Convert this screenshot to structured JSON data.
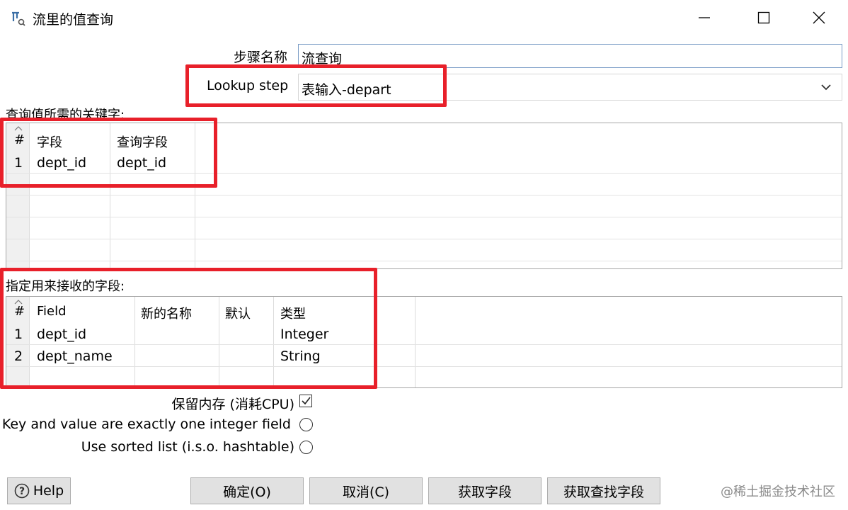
{
  "window": {
    "title": "流里的值查询",
    "icon": "lookup-step-icon"
  },
  "form": {
    "step_name_label": "步骤名称",
    "step_name_value": "流查询",
    "lookup_step_label": "Lookup step",
    "lookup_step_value": "表输入-depart"
  },
  "keys_section": {
    "label": "查询值所需的关键字:",
    "headers": [
      "#",
      "字段",
      "查询字段"
    ],
    "rows": [
      [
        "1",
        "dept_id",
        "dept_id"
      ]
    ]
  },
  "fields_section": {
    "label": "指定用来接收的字段:",
    "headers": [
      "#",
      "Field",
      "新的名称",
      "默认",
      "类型"
    ],
    "rows": [
      [
        "1",
        "dept_id",
        "",
        "",
        "Integer"
      ],
      [
        "2",
        "dept_name",
        "",
        "",
        "String"
      ]
    ]
  },
  "options": {
    "preserve_memory_label": "保留内存 (消耗CPU)",
    "preserve_memory_checked": true,
    "integer_pair_label": "Key and value are exactly one integer field",
    "sorted_list_label": "Use sorted list (i.s.o. hashtable)"
  },
  "buttons": {
    "help": "Help",
    "ok": "确定(O)",
    "cancel": "取消(C)",
    "get_fields": "获取字段",
    "get_lookup_fields": "获取查找字段"
  },
  "watermark": "@稀土掘金技术社区",
  "colors": {
    "highlight": "#e8202a",
    "input_border": "#7a9cc6"
  }
}
